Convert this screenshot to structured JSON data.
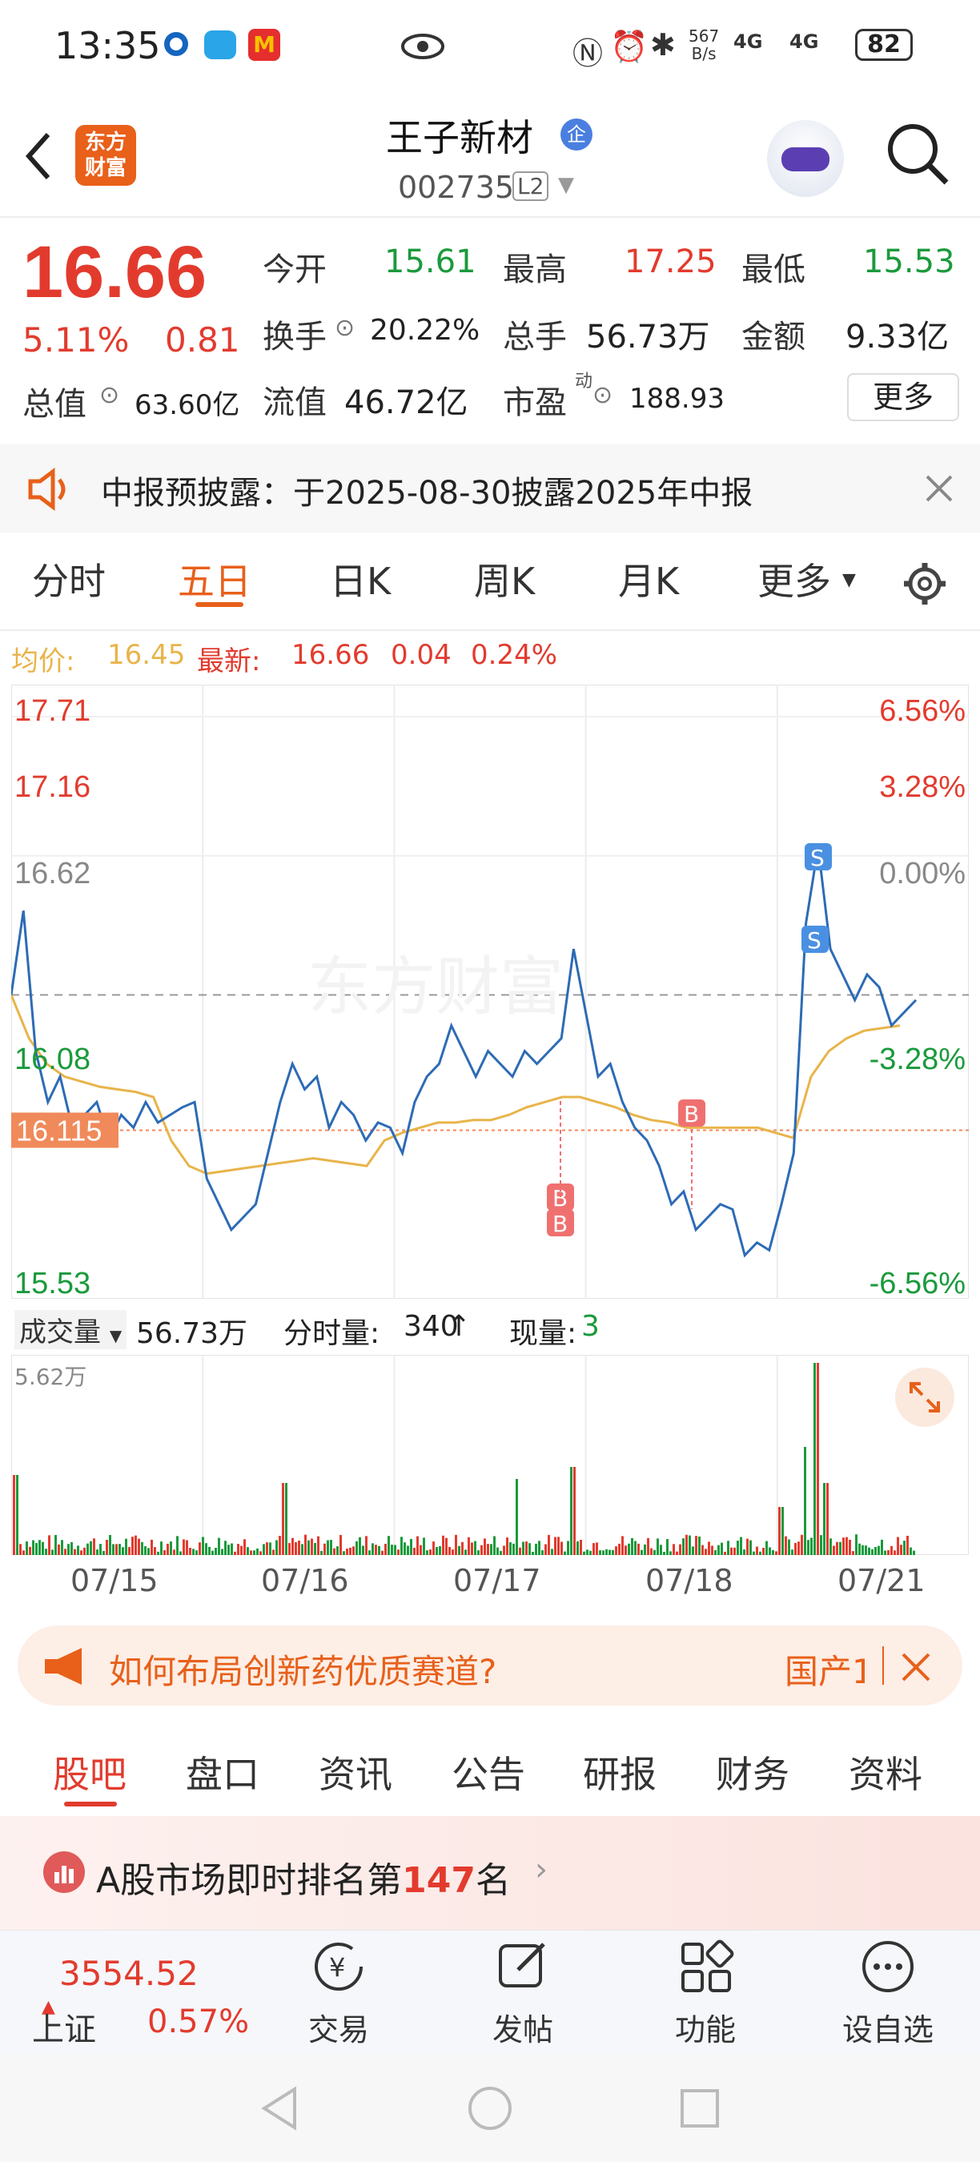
{
  "status_bar": {
    "time": "13:35",
    "net_speed_value": "567",
    "net_speed_unit": "B/s",
    "signal1": "4G",
    "signal2": "4G",
    "battery": "82"
  },
  "header": {
    "logo_line1": "东方",
    "logo_line2": "财富",
    "stock_name": "王子新材",
    "enterprise_badge": "企",
    "stock_code": "002735",
    "level_badge": "L2"
  },
  "quote": {
    "price": "16.66",
    "change_pct": "5.11%",
    "change_amt": "0.81",
    "open_label": "今开",
    "open": "15.61",
    "high_label": "最高",
    "high": "17.25",
    "low_label": "最低",
    "low": "15.53",
    "turnover_label": "换手",
    "turnover": "20.22%",
    "volume_label": "总手",
    "volume": "56.73万",
    "amount_label": "金额",
    "amount": "9.33亿",
    "mktcap_label": "总值",
    "mktcap": "63.60亿",
    "float_label": "流值",
    "float": "46.72亿",
    "pe_label": "市盈",
    "pe_sup": "动",
    "pe": "188.93",
    "more_button": "更多"
  },
  "notice": {
    "text": "中报预披露：于2025-08-30披露2025年中报"
  },
  "tabs": [
    "分时",
    "五日",
    "日K",
    "周K",
    "月K",
    "更多"
  ],
  "active_tab": 1,
  "chart_header": {
    "avg_label": "均价:",
    "avg_value": "16.45",
    "latest_label": "最新:",
    "latest_value": "16.66",
    "latest_change": "0.04",
    "latest_pct": "0.24%"
  },
  "chart_data": {
    "type": "line",
    "y_left_ticks": [
      "17.71",
      "17.16",
      "16.62",
      "16.08",
      "15.53"
    ],
    "y_right_ticks": [
      "6.56%",
      "3.28%",
      "0.00%",
      "-3.28%",
      "-6.56%"
    ],
    "cursor_price": "16.115",
    "x_labels": [
      "07/15",
      "07/16",
      "07/17",
      "07/18",
      "07/21"
    ],
    "ylim": [
      15.53,
      17.71
    ],
    "prev_close": 16.62,
    "series": [
      {
        "values": [
          16.62,
          16.95,
          16.4,
          16.2,
          16.3,
          16.1,
          16.15,
          16.2,
          16.05,
          16.15,
          16.1,
          16.2,
          16.12,
          16.15,
          16.18,
          16.2,
          15.9,
          15.8,
          15.7,
          15.75,
          15.8,
          16.0,
          16.2,
          16.35,
          16.25,
          16.3,
          16.1,
          16.2,
          16.15,
          16.05,
          16.12,
          16.1,
          16.0,
          16.2,
          16.3,
          16.35,
          16.5,
          16.4,
          16.3,
          16.4,
          16.35,
          16.3,
          16.4,
          16.35,
          16.4,
          16.45,
          16.8,
          16.55,
          16.3,
          16.35,
          16.2,
          16.1,
          16.05,
          15.95,
          15.8,
          15.85,
          15.7,
          15.75,
          15.8,
          15.78,
          15.6,
          15.65,
          15.62,
          15.8,
          16.0,
          16.9,
          17.2,
          16.8,
          16.7,
          16.6,
          16.7,
          16.65,
          16.5,
          16.55,
          16.6
        ]
      },
      {
        "values": [
          16.62,
          16.45,
          16.35,
          16.3,
          16.28,
          16.26,
          16.25,
          16.24,
          16.22,
          16.05,
          15.95,
          15.92,
          15.93,
          15.94,
          15.95,
          15.96,
          15.97,
          15.98,
          15.97,
          15.96,
          15.95,
          16.05,
          16.08,
          16.1,
          16.12,
          16.12,
          16.13,
          16.13,
          16.15,
          16.18,
          16.2,
          16.22,
          16.22,
          16.2,
          16.18,
          16.15,
          16.13,
          16.12,
          16.1,
          16.1,
          16.1,
          16.1,
          16.1,
          16.08,
          16.06,
          16.3,
          16.4,
          16.45,
          16.48,
          16.49,
          16.5
        ]
      }
    ],
    "buy_sell_markers": [
      "S",
      "S",
      "B",
      "B",
      "B"
    ],
    "volume_panel": {
      "label": "成交量",
      "total": "56.73万",
      "min_vol_label": "分时量:",
      "min_vol": "340",
      "min_vol_arrow": "↑",
      "now_label": "现量:",
      "now_vol": "3",
      "max_label": "5.62万"
    }
  },
  "ad": {
    "text": "如何布局创新药优质赛道?",
    "tail": "国产1"
  },
  "sub_tabs": [
    "股吧",
    "盘口",
    "资讯",
    "公告",
    "研报",
    "财务",
    "资料"
  ],
  "active_sub_tab": 0,
  "ranking": {
    "prefix": "A股市场即时排名第",
    "rank": "147",
    "suffix": "名"
  },
  "bottom": {
    "index_value": "3554.52",
    "index_name": "上证",
    "index_pct": "0.57%",
    "items": [
      "交易",
      "发帖",
      "功能",
      "设自选"
    ]
  },
  "colors": {
    "up": "#e23b2e",
    "down": "#1a9a3c",
    "accent": "#e8601a",
    "price_line": "#2d6bb5",
    "avg_line": "#e8b44a"
  }
}
